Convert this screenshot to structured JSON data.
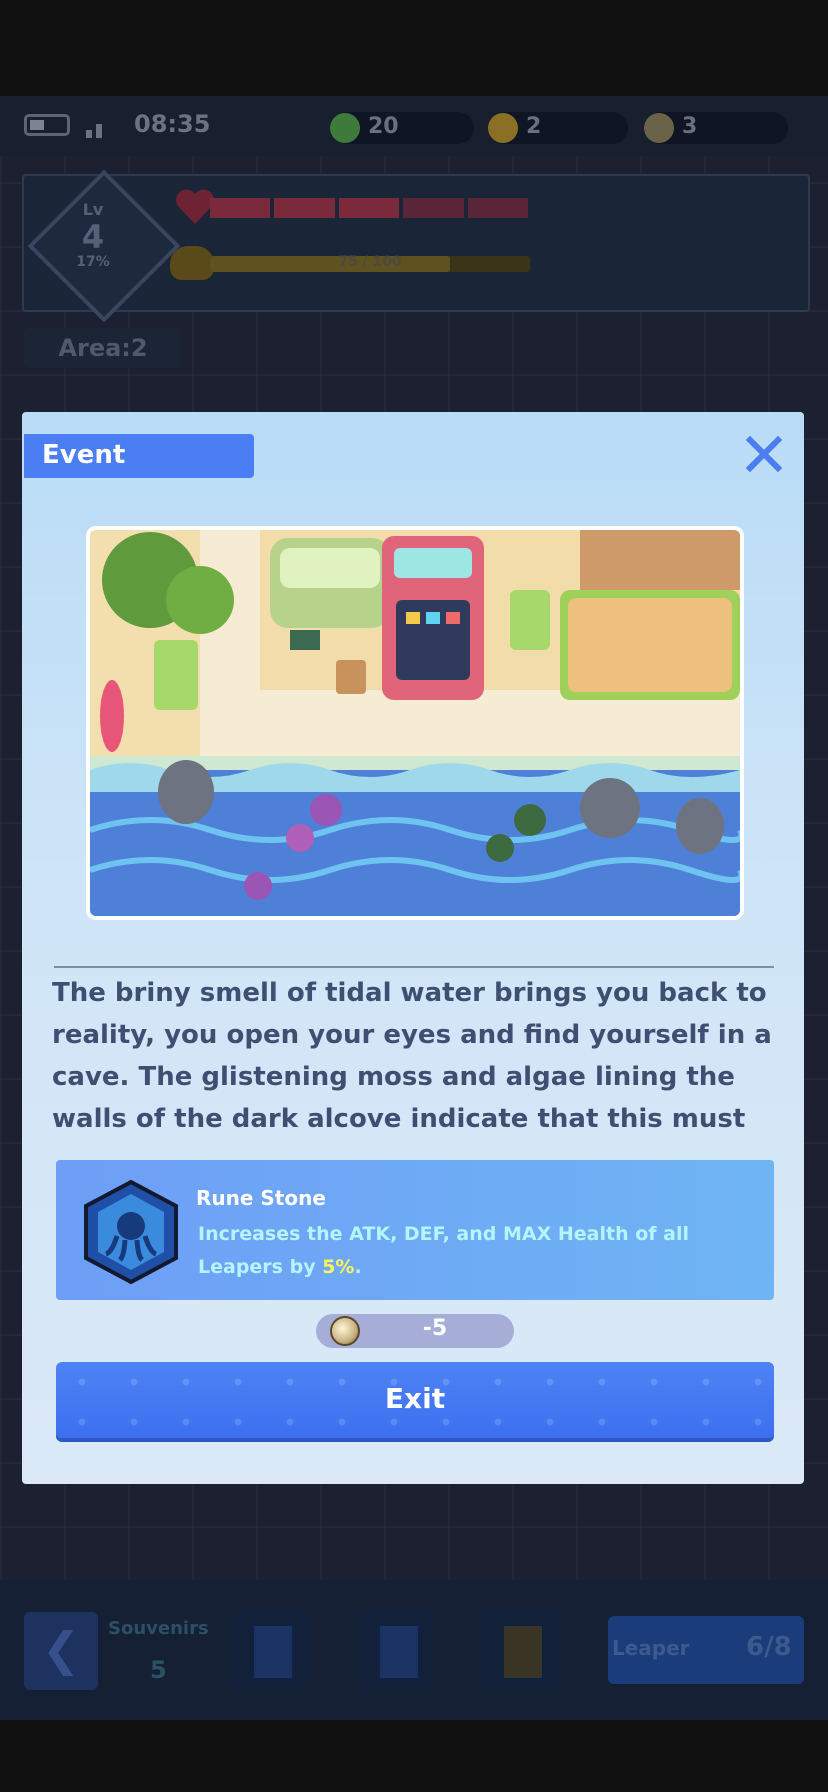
{
  "status_bar": {
    "time": "08:35",
    "battery_icon": "battery-icon",
    "signal_icon": "signal-icon"
  },
  "resources": [
    {
      "icon": "green-gem-icon",
      "value": "20",
      "color": "#3e7a3a"
    },
    {
      "icon": "gold-coin-icon",
      "value": "2",
      "color": "#8a6f24"
    },
    {
      "icon": "silver-coin-icon",
      "value": "3",
      "color": "#6b6348"
    }
  ],
  "player": {
    "level_label": "Lv",
    "level": "4",
    "level_progress": "17%",
    "hp_segments_total": 5,
    "hp_segments_filled": 3,
    "xp_text": "75 / 100",
    "xp_fraction": 0.75
  },
  "area": {
    "label": "Area:2"
  },
  "toolbar": {
    "back_icon": "chevron-left-icon",
    "souvenirs_label": "Souvenirs",
    "souvenirs_count": "5",
    "leaper_label": "Leaper",
    "leaper_count": "6/8"
  },
  "dialog": {
    "title": "Event",
    "close_icon": "close-icon",
    "image_icon": "beach-scene-illustration",
    "story_text": "The briny smell of tidal water brings you back to reality, you open your eyes and find yourself in a cave. The glistening moss and algae lining the walls of the dark alcove indicate that this must be a",
    "reward": {
      "icon": "rune-stone-icon",
      "name": "Rune Stone",
      "description": "Increases the ATK, DEF, and MAX Health of all Leapers by ",
      "percent": "5%",
      "description_end": "."
    },
    "cost": {
      "icon": "coin-icon",
      "value": "-5"
    },
    "exit_label": "Exit"
  },
  "colors": {
    "accent": "#4a7ef2",
    "story_text": "#3f4f72",
    "highlight": "#f7f55b"
  }
}
